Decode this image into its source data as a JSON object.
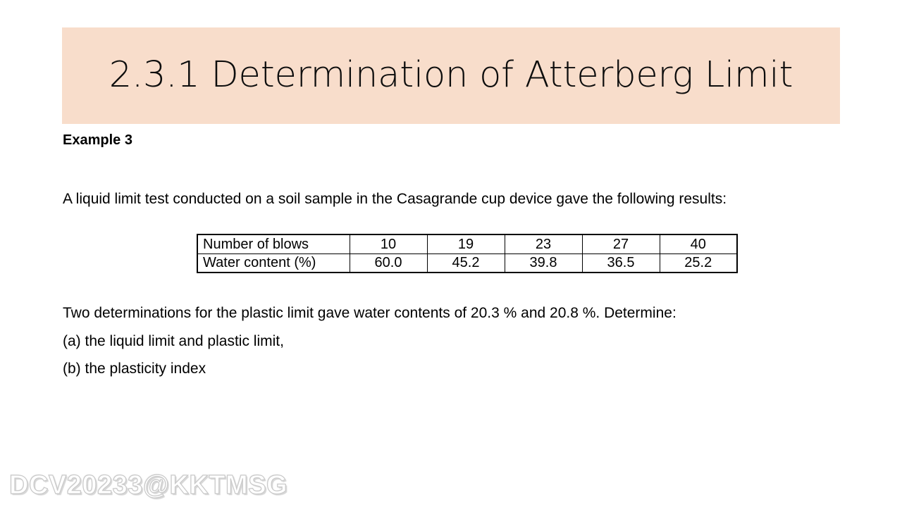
{
  "slide": {
    "title": "2.3.1 Determination of Atterberg Limit",
    "banner_color": "#f8ddcb",
    "text_color": "#000000"
  },
  "body": {
    "example_label": "Example 3",
    "intro": "A liquid limit test conducted on a soil sample in the Casagrande cup device gave the following results:",
    "plastic_limit_line": "Two determinations for the plastic limit gave water contents of 20.3 % and 20.8 %. Determine:",
    "question_a": "(a) the liquid limit and plastic limit,",
    "question_b": "(b) the plasticity index"
  },
  "table": {
    "rows": [
      {
        "label": "Number of blows",
        "values": [
          "10",
          "19",
          "23",
          "27",
          "40"
        ]
      },
      {
        "label": "Water content (%)",
        "values": [
          "60.0",
          "45.2",
          "39.8",
          "36.5",
          "25.2"
        ]
      }
    ]
  },
  "watermark": {
    "text": "DCV20233@KKTMSG",
    "color": "#d8d8d8"
  }
}
